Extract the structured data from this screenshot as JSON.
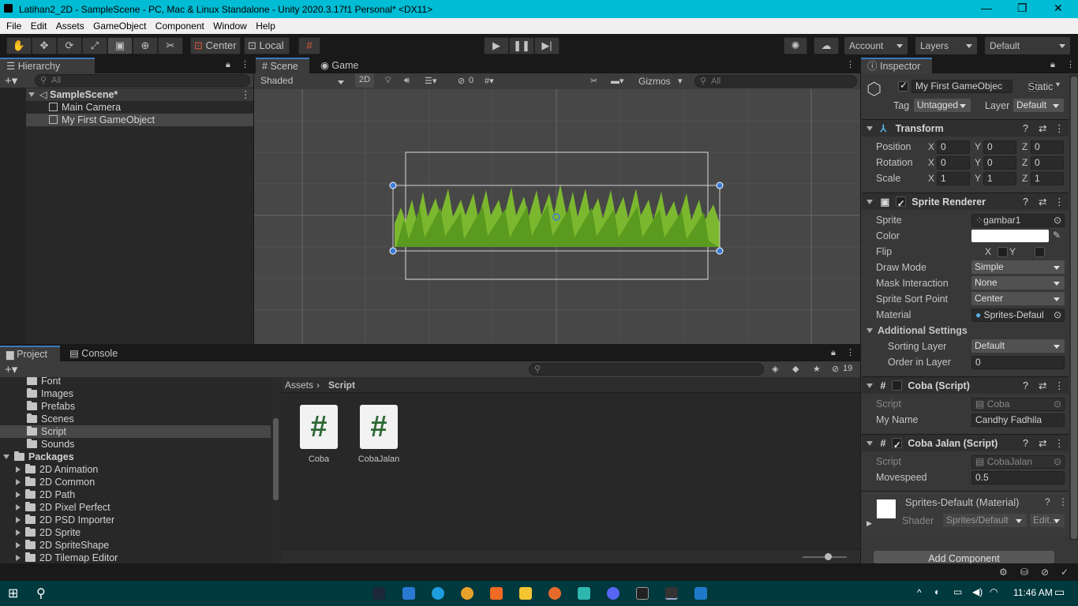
{
  "window": {
    "title": "Latihan2_2D - SampleScene - PC, Mac & Linux Standalone - Unity 2020.3.17f1 Personal* <DX11>"
  },
  "menu": [
    "File",
    "Edit",
    "Assets",
    "GameObject",
    "Component",
    "Window",
    "Help"
  ],
  "toolbar": {
    "center": "Center",
    "local": "Local",
    "account": "Account",
    "layers": "Layers",
    "layout": "Default"
  },
  "hierarchy": {
    "tab": "Hierarchy",
    "search_placeholder": "All",
    "scene": "SampleScene*",
    "items": [
      "Main Camera",
      "My First GameObject"
    ]
  },
  "scene": {
    "tabs": [
      "Scene",
      "Game"
    ],
    "shading": "Shaded",
    "mode2d": "2D",
    "hidden_count": "0",
    "gizmos": "Gizmos",
    "search_placeholder": "All"
  },
  "project": {
    "tabs": [
      "Project",
      "Console"
    ],
    "hidden_count": "19",
    "assets_folders": [
      "Font",
      "Images",
      "Prefabs",
      "Scenes",
      "Script",
      "Sounds"
    ],
    "packages_label": "Packages",
    "packages": [
      "2D Animation",
      "2D Common",
      "2D Path",
      "2D Pixel Perfect",
      "2D PSD Importer",
      "2D Sprite",
      "2D SpriteShape",
      "2D Tilemap Editor"
    ],
    "breadcrumb": [
      "Assets",
      "Script"
    ],
    "files": [
      "Coba",
      "CobaJalan"
    ]
  },
  "inspector": {
    "tab": "Inspector",
    "object_name": "My First GameObjec",
    "static": "Static",
    "tag_label": "Tag",
    "tag": "Untagged",
    "layer_label": "Layer",
    "layer": "Default",
    "transform": {
      "title": "Transform",
      "rows": [
        {
          "label": "Position",
          "x": "0",
          "y": "0",
          "z": "0"
        },
        {
          "label": "Rotation",
          "x": "0",
          "y": "0",
          "z": "0"
        },
        {
          "label": "Scale",
          "x": "1",
          "y": "1",
          "z": "1"
        }
      ]
    },
    "sprite_renderer": {
      "title": "Sprite Renderer",
      "sprite_label": "Sprite",
      "sprite": "gambar1",
      "color_label": "Color",
      "flip_label": "Flip",
      "flip_x": "X",
      "flip_y": "Y",
      "draw_mode_label": "Draw Mode",
      "draw_mode": "Simple",
      "mask_label": "Mask Interaction",
      "mask": "None",
      "sort_point_label": "Sprite Sort Point",
      "sort_point": "Center",
      "material_label": "Material",
      "material": "Sprites-Defaul",
      "additional": "Additional Settings",
      "sorting_layer_label": "Sorting Layer",
      "sorting_layer": "Default",
      "order_label": "Order in Layer",
      "order": "0"
    },
    "coba": {
      "title": "Coba (Script)",
      "script_label": "Script",
      "script": "Coba",
      "myname_label": "My Name",
      "myname": "Candhy Fadhila"
    },
    "coba_jalan": {
      "title": "Coba Jalan (Script)",
      "script_label": "Script",
      "script": "CobaJalan",
      "movespeed_label": "Movespeed",
      "movespeed": "0.5"
    },
    "material": {
      "title": "Sprites-Default (Material)",
      "shader_label": "Shader",
      "shader": "Sprites/Default",
      "edit": "Edit..."
    },
    "add_component": "Add Component"
  },
  "taskbar": {
    "time": "11:46 AM"
  }
}
